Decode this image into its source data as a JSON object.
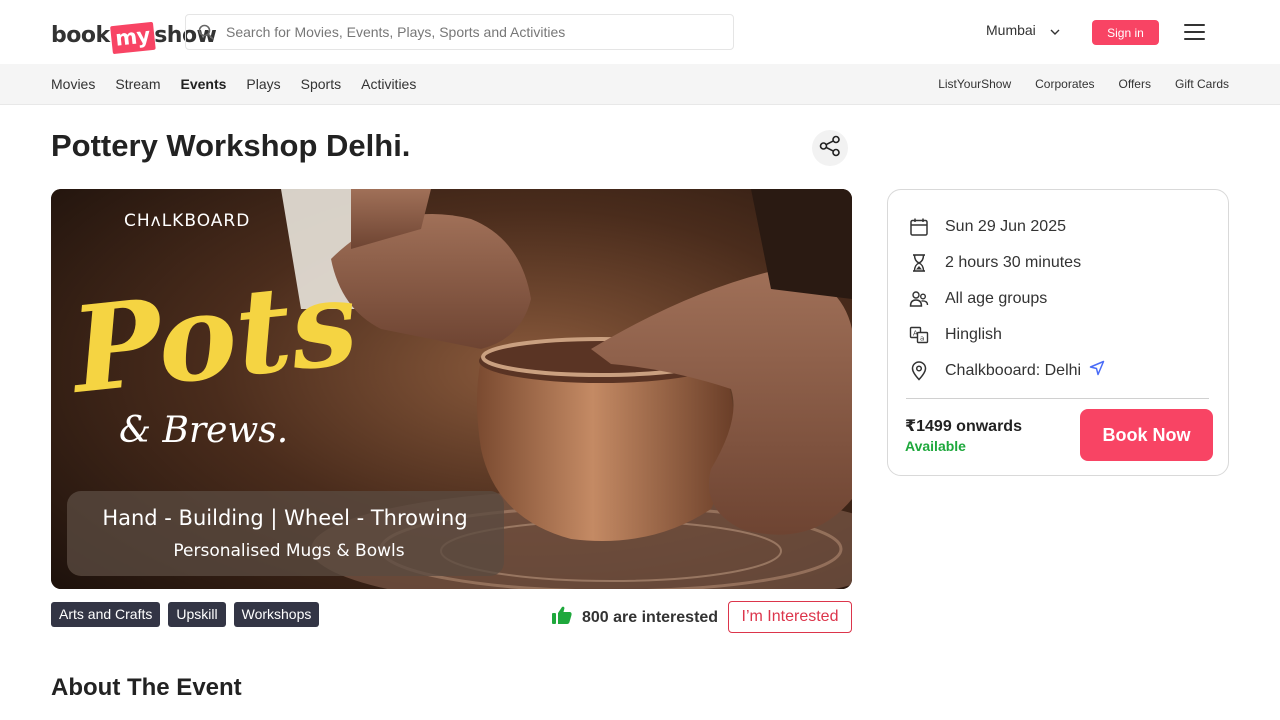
{
  "header": {
    "logo": {
      "part1": "book",
      "part2": "my",
      "part3": "show"
    },
    "search_placeholder": "Search for Movies, Events, Plays, Sports and Activities",
    "city": "Mumbai",
    "signin_label": "Sign in"
  },
  "nav": {
    "left": [
      "Movies",
      "Stream",
      "Events",
      "Plays",
      "Sports",
      "Activities"
    ],
    "active": "Events",
    "right": [
      "ListYourShow",
      "Corporates",
      "Offers",
      "Gift Cards"
    ]
  },
  "event": {
    "title": "Pottery Workshop Delhi.",
    "banner": {
      "brand": "CHʌLKBOARD",
      "headline": "Pots",
      "sub_headline": "& Brews.",
      "line1": "Hand - Building | Wheel - Throwing",
      "line2": "Personalised Mugs & Bowls"
    },
    "tags": [
      "Arts and Crafts",
      "Upskill",
      "Workshops"
    ],
    "interested_text": "800 are interested",
    "interested_button": "I’m Interested",
    "about_heading": "About The Event"
  },
  "card": {
    "date": "Sun 29 Jun 2025",
    "duration": "2 hours 30 minutes",
    "age": "All age groups",
    "language": "Hinglish",
    "venue": "Chalkbooard: Delhi",
    "price": "₹1499 onwards",
    "availability": "Available",
    "book_label": "Book Now"
  },
  "colors": {
    "brand": "#f84464",
    "interested": "#dc354b",
    "available": "#1ea83c",
    "tag_bg": "#333545",
    "thumb": "#1ea83c",
    "banner_yellow": "#f5d442"
  },
  "icons": {
    "search": "search-icon",
    "chevron": "chevron-down-icon",
    "menu": "hamburger-icon",
    "share": "share-icon",
    "calendar": "calendar-icon",
    "hourglass": "hourglass-icon",
    "people": "people-icon",
    "language": "language-icon",
    "location": "location-pin-icon",
    "directions": "directions-icon",
    "thumb": "thumbs-up-icon"
  }
}
